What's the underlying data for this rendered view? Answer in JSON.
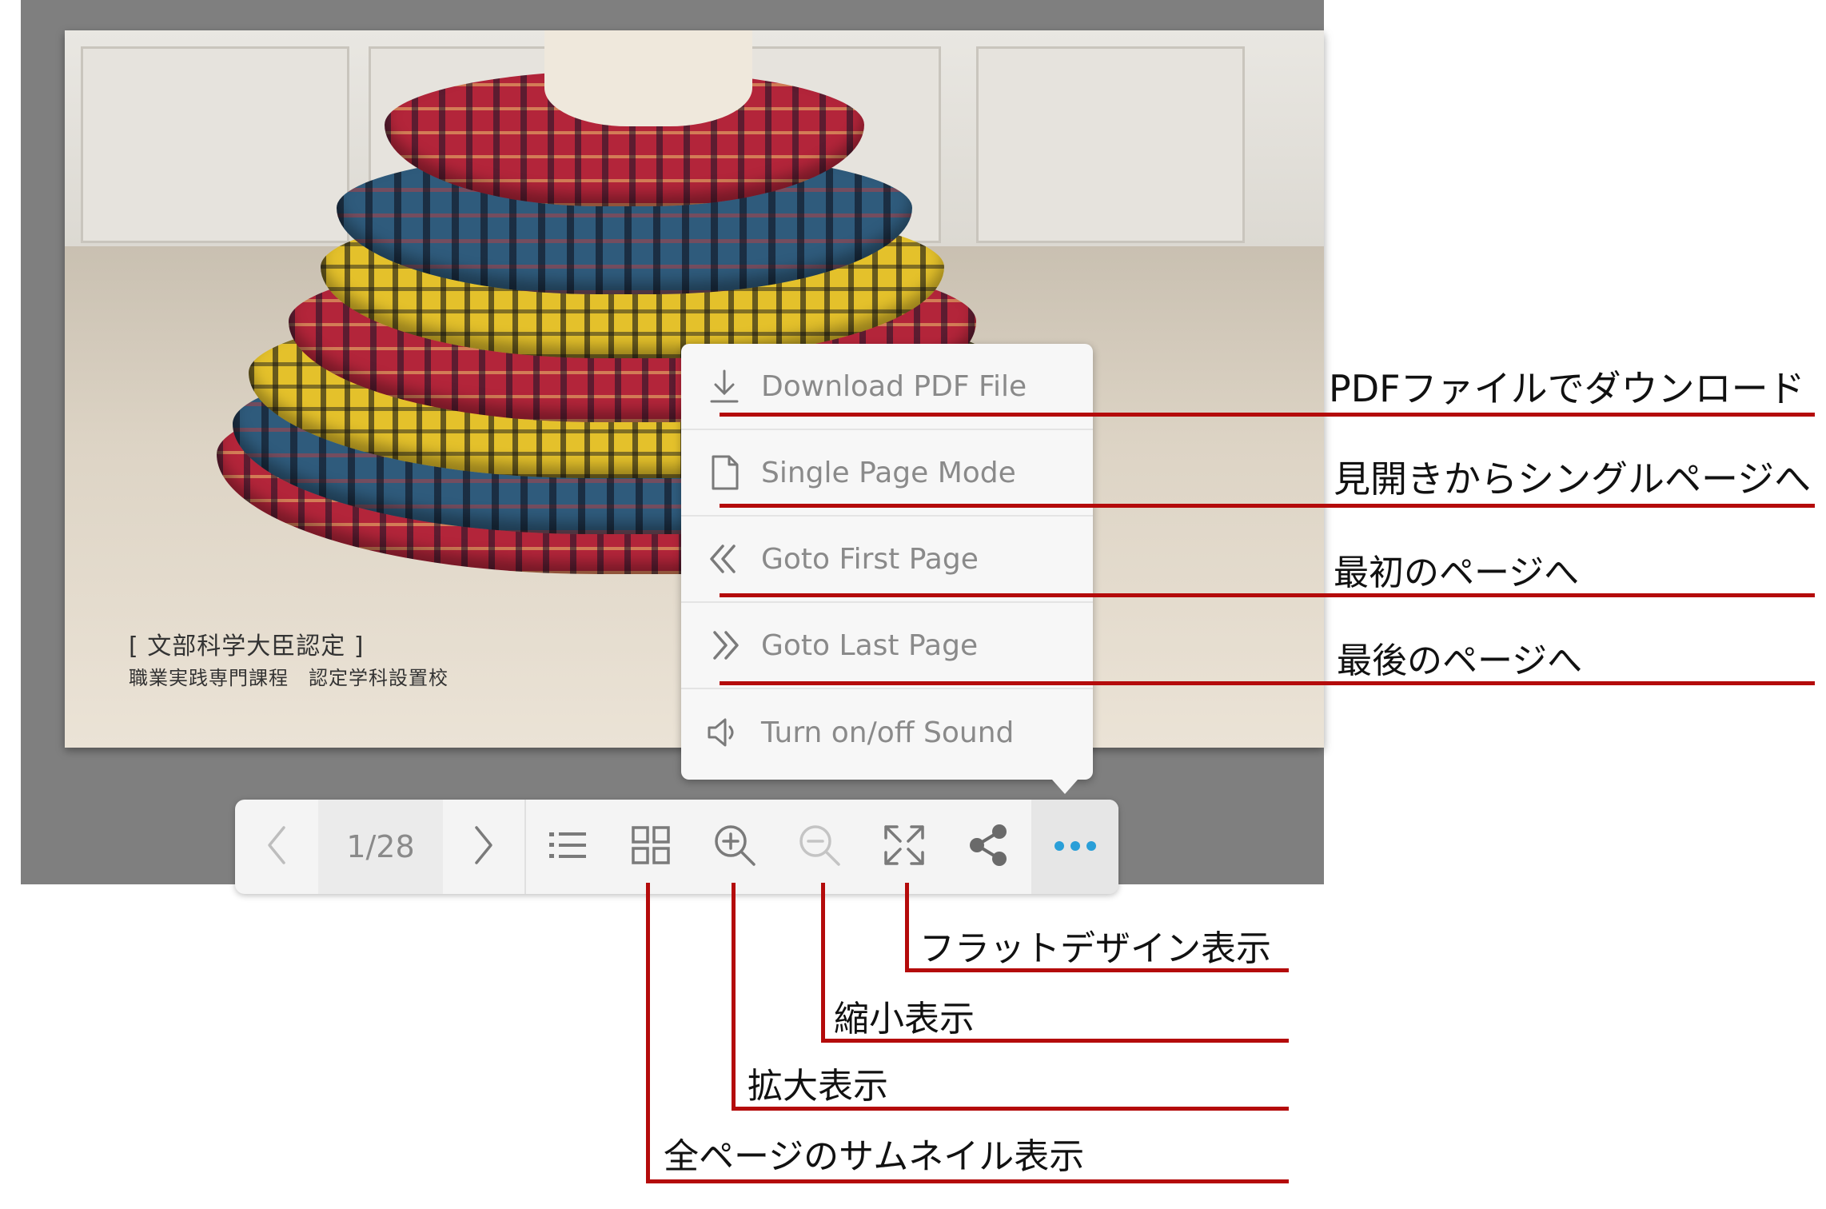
{
  "page": {
    "caption_line1": "[ 文部科学大臣認定 ]",
    "caption_line2": "職業実践専門課程　認定学科設置校"
  },
  "menu": {
    "items": [
      {
        "label": "Download PDF File",
        "icon": "download-icon"
      },
      {
        "label": "Single Page Mode",
        "icon": "page-icon"
      },
      {
        "label": "Goto First Page",
        "icon": "double-chevron-left-icon"
      },
      {
        "label": "Goto Last Page",
        "icon": "double-chevron-right-icon"
      },
      {
        "label": "Turn on/off Sound",
        "icon": "speaker-icon"
      }
    ]
  },
  "toolbar": {
    "page_indicator": "1/28",
    "buttons": [
      "chevron-left-icon",
      "chevron-right-icon",
      "list-icon",
      "grid-icon",
      "zoom-in-icon",
      "zoom-out-icon",
      "fullscreen-icon",
      "share-icon",
      "more-icon"
    ]
  },
  "annotations": {
    "download": "PDFファイルでダウンロード",
    "single_page": "見開きからシングルページへ",
    "first_page": "最初のページへ",
    "last_page": "最後のページへ",
    "flat_design": "フラットデザイン表示",
    "zoom_out": "縮小表示",
    "zoom_in": "拡大表示",
    "thumbnails": "全ページのサムネイル表示"
  },
  "colors": {
    "annotation_line": "#b40b0b",
    "icon_gray": "#7a7a7a",
    "accent_blue": "#2a9fd8"
  }
}
